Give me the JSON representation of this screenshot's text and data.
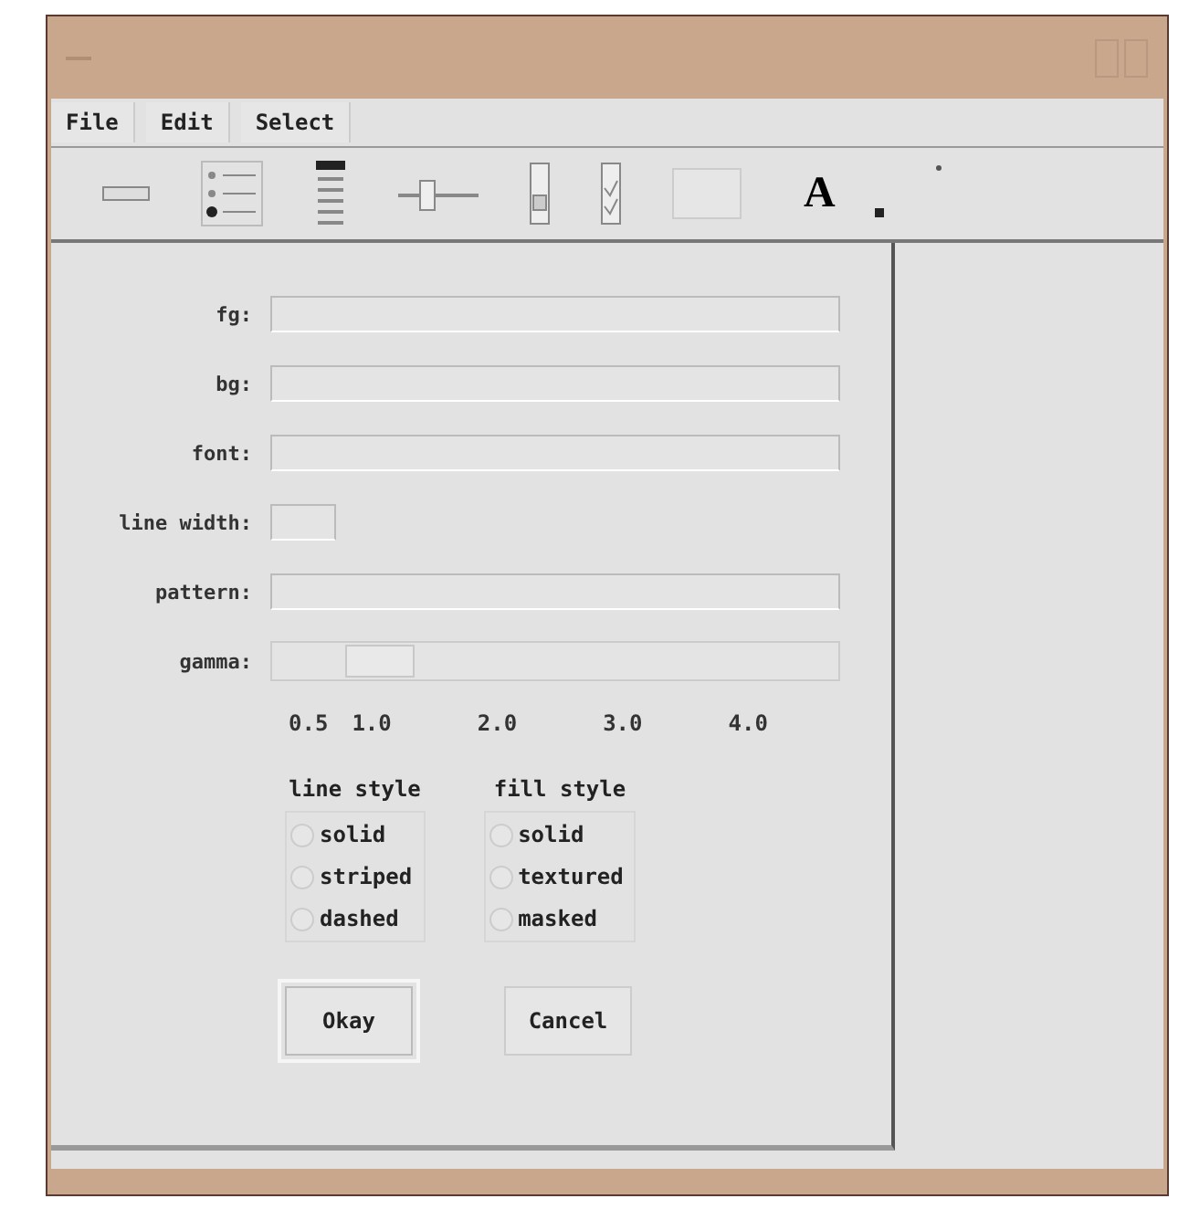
{
  "menu": [
    {
      "label": "File"
    },
    {
      "label": "Edit"
    },
    {
      "label": "Select"
    }
  ],
  "toolbar": {
    "text_tool": "A"
  },
  "fields": [
    {
      "label": "fg:",
      "kind": "text"
    },
    {
      "label": "bg:",
      "kind": "text"
    },
    {
      "label": "font:",
      "kind": "text"
    },
    {
      "label": "line width:",
      "kind": "short"
    },
    {
      "label": "pattern:",
      "kind": "text"
    }
  ],
  "gamma": {
    "label": "gamma:",
    "level": 0.19,
    "ticks": [
      "0.5",
      "1.0",
      "2.0",
      "3.0",
      "4.0"
    ]
  },
  "radio_groups": [
    {
      "title": "line style",
      "options": [
        {
          "label": "solid",
          "selected": false
        },
        {
          "label": "striped",
          "selected": false
        },
        {
          "label": "dashed",
          "selected": false
        }
      ]
    },
    {
      "title": "fill style",
      "options": [
        {
          "label": "solid",
          "selected": false
        },
        {
          "label": "textured",
          "selected": false
        },
        {
          "label": "masked",
          "selected": false
        }
      ]
    }
  ],
  "buttons": [
    {
      "label": "Okay",
      "default": true
    },
    {
      "label": "Cancel",
      "default": false
    }
  ]
}
